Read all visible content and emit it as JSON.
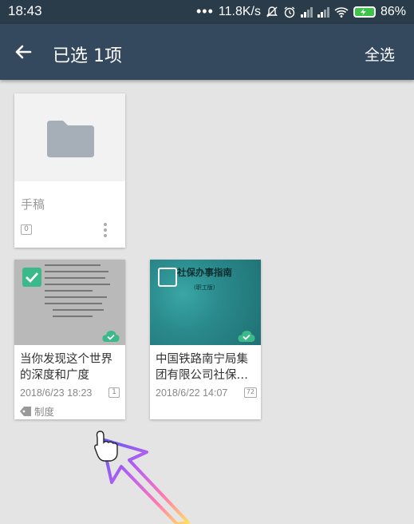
{
  "status_bar": {
    "time": "18:43",
    "speed": "11.8K/s",
    "battery": "86%"
  },
  "toolbar": {
    "title": "已选 1项",
    "select_all": "全选"
  },
  "folder": {
    "name": "手稿",
    "count": "0"
  },
  "notes": [
    {
      "title": "当你发现这个世界的深度和广度",
      "date": "2018/6/23 18:23",
      "pages": "1",
      "tag": "制度",
      "selected": true
    },
    {
      "title": "中国铁路南宁局集团有限公司社保…",
      "date": "2018/6/22 14:07",
      "pages": "72",
      "thumb_text": "社保办事指南",
      "thumb_subtext": "(职工版)",
      "selected": false
    }
  ],
  "colors": {
    "toolbar": "#34495e",
    "statusbar": "#2a3b4a",
    "accent": "#3cb98a",
    "background": "#e4e4e4"
  }
}
